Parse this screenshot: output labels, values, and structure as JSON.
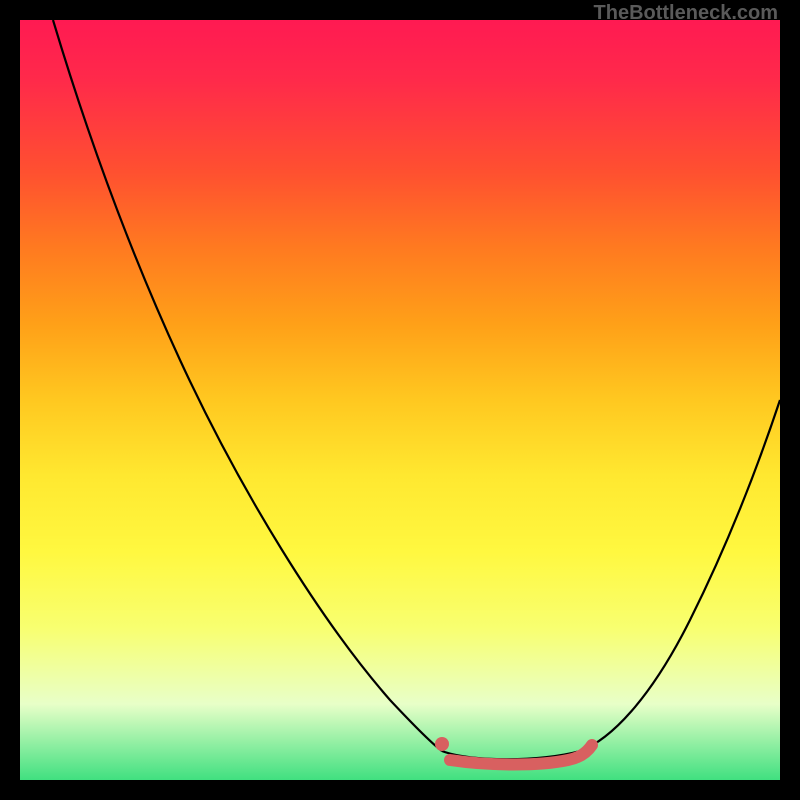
{
  "attribution": "TheBottleneck.com",
  "colors": {
    "gradient_top": "#ff1a52",
    "gradient_mid": "#ffe830",
    "gradient_bottom": "#40e080",
    "curve": "#000000",
    "marker": "#d86060",
    "frame": "#000000"
  },
  "chart_data": {
    "type": "line",
    "title": "",
    "xlabel": "",
    "ylabel": "",
    "xlim": [
      0,
      100
    ],
    "ylim": [
      0,
      100
    ],
    "grid": false,
    "legend": false,
    "series": [
      {
        "name": "left-branch",
        "x": [
          4,
          10,
          18,
          26,
          34,
          42,
          49,
          54,
          56
        ],
        "y": [
          100,
          85,
          68,
          52,
          36,
          20,
          8,
          2,
          0
        ]
      },
      {
        "name": "valley",
        "x": [
          56,
          60,
          66,
          72,
          74
        ],
        "y": [
          0,
          0,
          0,
          0,
          0
        ]
      },
      {
        "name": "right-branch",
        "x": [
          74,
          80,
          86,
          92,
          100
        ],
        "y": [
          0,
          6,
          16,
          30,
          50
        ]
      }
    ],
    "annotations": [
      {
        "name": "optimal-range-highlight",
        "x_start": 56,
        "x_end": 75,
        "y": 0,
        "color": "#d86060"
      }
    ],
    "background": "vertical-gradient red→yellow→green (high→low bottleneck)"
  }
}
